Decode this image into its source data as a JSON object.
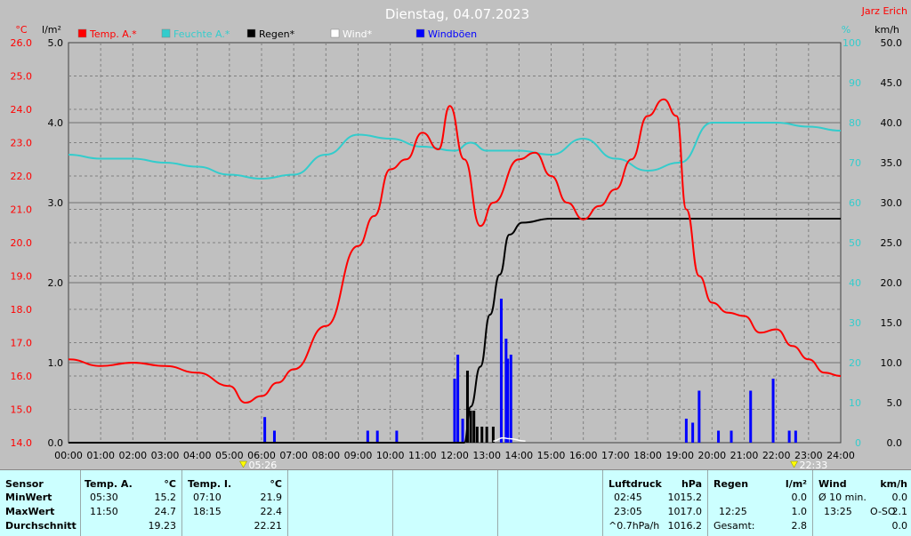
{
  "title": "Dienstag, 04.07.2023",
  "station": "Jarz Erich",
  "colors": {
    "temp": "#ff0000",
    "humidity": "#33cccc",
    "rain": "#000000",
    "wind": "#ffffff",
    "gust": "#0000ff",
    "plot_bg": "#c0c0c0",
    "grid": "#808080",
    "stats_bg": "#ccffff"
  },
  "legend": [
    {
      "label": "Temp. A.*",
      "color": "#ff0000"
    },
    {
      "label": "Feuchte A.*",
      "color": "#33cccc"
    },
    {
      "label": "Regen*",
      "color": "#000000"
    },
    {
      "label": "Wind*",
      "color": "#ffffff"
    },
    {
      "label": "Windböen",
      "color": "#0000ff"
    }
  ],
  "axes": {
    "temp_unit": "°C",
    "rain_unit": "l/m²",
    "hum_unit": "%",
    "wind_unit": "km/h",
    "temp_ticks": [
      "26.0",
      "25.0",
      "24.0",
      "23.0",
      "22.0",
      "21.0",
      "20.0",
      "19.0",
      "18.0",
      "17.0",
      "16.0",
      "15.0",
      "14.0"
    ],
    "rain_ticks": [
      "5.0",
      "4.0",
      "3.0",
      "2.0",
      "1.0",
      "0.0"
    ],
    "hum_ticks": [
      "100",
      "90",
      "80",
      "70",
      "60",
      "50",
      "40",
      "30",
      "20",
      "10",
      "0"
    ],
    "wind_ticks": [
      "50.0",
      "45.0",
      "40.0",
      "35.0",
      "30.0",
      "25.0",
      "20.0",
      "15.0",
      "10.0",
      "5.0",
      "0.0"
    ],
    "time_ticks": [
      "00:00",
      "01:00",
      "02:00",
      "03:00",
      "04:00",
      "05:00",
      "06:00",
      "07:00",
      "08:00",
      "09:00",
      "10:00",
      "11:00",
      "12:00",
      "13:00",
      "14:00",
      "15:00",
      "16:00",
      "17:00",
      "18:00",
      "19:00",
      "20:00",
      "21:00",
      "22:00",
      "23:00",
      "24:00"
    ],
    "sunrise": "05:26",
    "sunset": "22:33"
  },
  "chart_data": {
    "type": "line",
    "title": "Dienstag, 04.07.2023",
    "x_unit": "hours",
    "xlim": [
      0,
      24
    ],
    "temp_ylim": [
      14,
      26
    ],
    "rain_ylim": [
      0,
      5
    ],
    "hum_ylim": [
      0,
      100
    ],
    "wind_ylim": [
      0,
      50
    ],
    "grid": true,
    "legend_position": "top",
    "series": [
      {
        "name": "Temp. A.*",
        "axis": "temp",
        "points": [
          [
            0,
            16.5
          ],
          [
            1,
            16.3
          ],
          [
            2,
            16.4
          ],
          [
            3,
            16.3
          ],
          [
            4,
            16.1
          ],
          [
            5,
            15.7
          ],
          [
            5.5,
            15.2
          ],
          [
            6,
            15.4
          ],
          [
            6.5,
            15.8
          ],
          [
            7,
            16.2
          ],
          [
            8,
            17.5
          ],
          [
            9,
            19.9
          ],
          [
            9.5,
            20.8
          ],
          [
            10,
            22.2
          ],
          [
            10.5,
            22.5
          ],
          [
            11,
            23.3
          ],
          [
            11.5,
            22.8
          ],
          [
            11.85,
            24.1
          ],
          [
            12.3,
            22.5
          ],
          [
            12.8,
            20.5
          ],
          [
            13.2,
            21.2
          ],
          [
            14,
            22.5
          ],
          [
            14.5,
            22.7
          ],
          [
            15,
            22.0
          ],
          [
            15.5,
            21.2
          ],
          [
            16,
            20.7
          ],
          [
            16.5,
            21.1
          ],
          [
            17,
            21.6
          ],
          [
            17.5,
            22.5
          ],
          [
            18,
            23.8
          ],
          [
            18.5,
            24.3
          ],
          [
            18.9,
            23.8
          ],
          [
            19.2,
            21.0
          ],
          [
            19.6,
            19.0
          ],
          [
            20,
            18.2
          ],
          [
            20.5,
            17.9
          ],
          [
            21,
            17.8
          ],
          [
            21.5,
            17.3
          ],
          [
            22,
            17.4
          ],
          [
            22.5,
            16.9
          ],
          [
            23,
            16.5
          ],
          [
            23.5,
            16.1
          ],
          [
            24,
            16.0
          ]
        ]
      },
      {
        "name": "Feuchte A.*",
        "axis": "hum",
        "points": [
          [
            0,
            72
          ],
          [
            1,
            71
          ],
          [
            2,
            71
          ],
          [
            3,
            70
          ],
          [
            4,
            69
          ],
          [
            5,
            67
          ],
          [
            6,
            66
          ],
          [
            7,
            67
          ],
          [
            8,
            72
          ],
          [
            9,
            77
          ],
          [
            10,
            76
          ],
          [
            11,
            74
          ],
          [
            12,
            73
          ],
          [
            12.5,
            75
          ],
          [
            13,
            73
          ],
          [
            14,
            73
          ],
          [
            15,
            72
          ],
          [
            16,
            76
          ],
          [
            17,
            71
          ],
          [
            18,
            68
          ],
          [
            19,
            70
          ],
          [
            20,
            80
          ],
          [
            21,
            80
          ],
          [
            22,
            80
          ],
          [
            23,
            79
          ],
          [
            24,
            78
          ]
        ]
      },
      {
        "name": "Regen*",
        "axis": "rain",
        "points": [
          [
            0,
            0
          ],
          [
            12.3,
            0
          ],
          [
            12.5,
            0.45
          ],
          [
            12.8,
            0.95
          ],
          [
            13.1,
            1.6
          ],
          [
            13.4,
            2.1
          ],
          [
            13.7,
            2.6
          ],
          [
            14.1,
            2.75
          ],
          [
            15,
            2.8
          ],
          [
            24,
            2.8
          ]
        ]
      },
      {
        "name": "Windböen",
        "axis": "wind",
        "bars": [
          [
            6.1,
            3.2
          ],
          [
            6.4,
            1.5
          ],
          [
            9.3,
            1.5
          ],
          [
            9.6,
            1.5
          ],
          [
            10.2,
            1.5
          ],
          [
            12.0,
            8.0
          ],
          [
            12.1,
            11.0
          ],
          [
            12.25,
            3.0
          ],
          [
            13.45,
            18.0
          ],
          [
            13.6,
            13.0
          ],
          [
            13.65,
            10.5
          ],
          [
            13.75,
            11.0
          ],
          [
            19.2,
            3.0
          ],
          [
            19.4,
            2.5
          ],
          [
            19.6,
            6.5
          ],
          [
            20.2,
            1.5
          ],
          [
            20.6,
            1.5
          ],
          [
            21.2,
            6.5
          ],
          [
            21.9,
            8.0
          ],
          [
            22.4,
            1.5
          ],
          [
            22.6,
            1.5
          ]
        ]
      },
      {
        "name": "Wind*",
        "axis": "wind",
        "points": [
          [
            13.2,
            0.2
          ],
          [
            13.5,
            0.6
          ],
          [
            13.7,
            0.5
          ],
          [
            14.2,
            0.2
          ]
        ]
      }
    ]
  },
  "stats": {
    "sensor": {
      "header": "Sensor",
      "min": "MinWert",
      "max": "MaxWert",
      "avg": "Durchschnitt"
    },
    "temp_a": {
      "header": "Temp. A.",
      "unit": "°C",
      "min_time": "05:30",
      "min_val": "15.2",
      "max_time": "11:50",
      "max_val": "24.7",
      "avg": "19.23"
    },
    "temp_i": {
      "header": "Temp. I.",
      "unit": "°C",
      "min_time": "07:10",
      "min_val": "21.9",
      "max_time": "18:15",
      "max_val": "22.4",
      "avg": "22.21"
    },
    "pressure": {
      "header": "Luftdruck",
      "unit": "hPa",
      "min_time": "02:45",
      "min_val": "1015.2",
      "max_time": "23:05",
      "max_val": "1017.0",
      "trend": "^0.7hPa/h",
      "trend_val": "1016.2"
    },
    "rain": {
      "header": "Regen",
      "unit": "l/m²",
      "min_val": "0.0",
      "max_time": "12:25",
      "max_val": "1.0",
      "total_label": "Gesamt:",
      "total": "2.8"
    },
    "wind": {
      "header": "Wind",
      "unit": "km/h",
      "avg_label": "Ø 10 min.",
      "avg_val": "0.0",
      "max_time": "13:25",
      "max_dir": "O-SO",
      "max_val": "2.1",
      "last_val": "0.0"
    }
  }
}
